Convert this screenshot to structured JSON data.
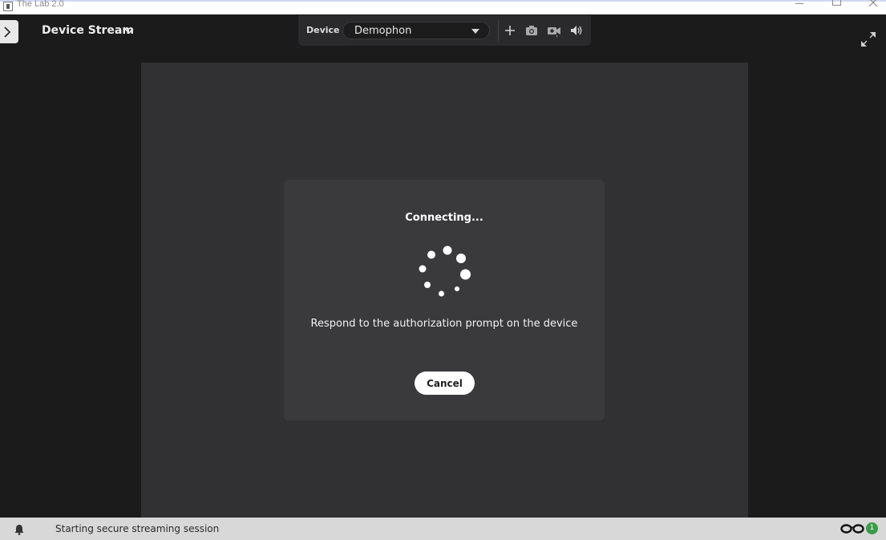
{
  "window": {
    "title": "The Lab 2.0"
  },
  "header": {
    "stream_title": "Device Stream"
  },
  "device_bar": {
    "label": "Device",
    "selected_device": "Demophon"
  },
  "dialog": {
    "title": "Connecting...",
    "message": "Respond to the authorization prompt on the device",
    "cancel_label": "Cancel"
  },
  "status_bar": {
    "message": "Starting secure streaming session",
    "badge_count": "1"
  }
}
